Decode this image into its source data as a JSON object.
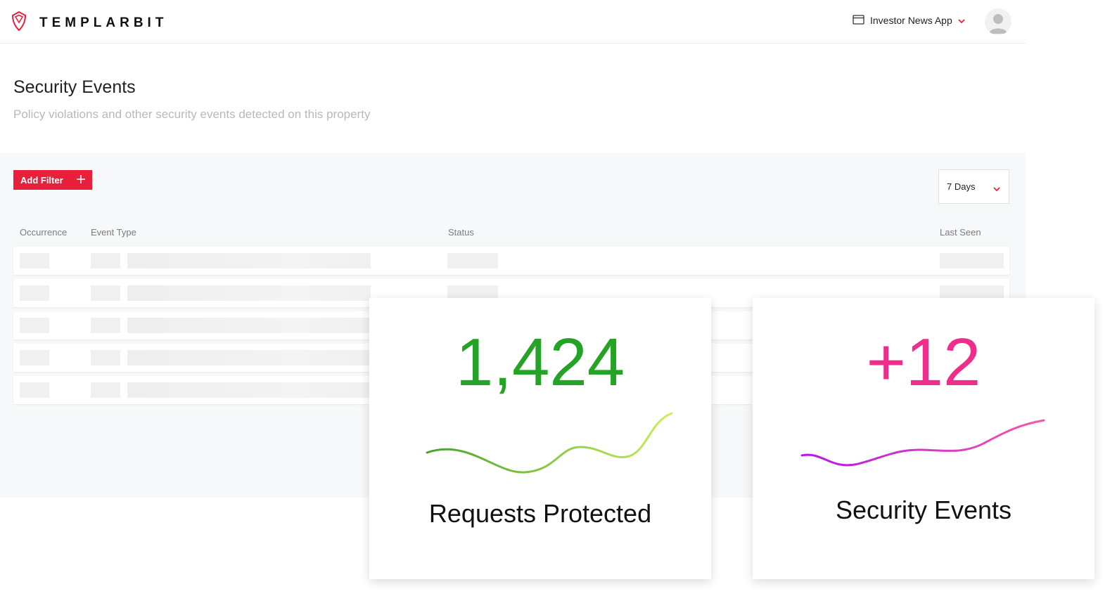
{
  "header": {
    "logo_text": "TEMPLARBIT",
    "app_name": "Investor News App",
    "brand_color": "#e8203c",
    "icons": {
      "logo": "shield-logo-icon",
      "app": "window-icon",
      "chevron": "chevron-down-icon",
      "avatar": "user-avatar-icon"
    }
  },
  "page": {
    "title": "Security Events",
    "subtitle": "Policy violations and other security events detected on this property"
  },
  "toolbar": {
    "add_filter_label": "Add Filter",
    "add_filter_icon": "plus-icon",
    "time_range": "7 Days"
  },
  "table": {
    "columns": [
      "Occurrence",
      "Event Type",
      "Status",
      "Last Seen"
    ],
    "rows_loading": 5
  },
  "stats": [
    {
      "value": "1,424",
      "label": "Requests Protected",
      "color": "#25a327",
      "spark_colors": [
        "#4aa12e",
        "#c9ef5c"
      ]
    },
    {
      "value": "+12",
      "label": "Security Events",
      "color": "#ef2d8a",
      "spark_colors": [
        "#b616e6",
        "#f25aa6"
      ]
    }
  ]
}
